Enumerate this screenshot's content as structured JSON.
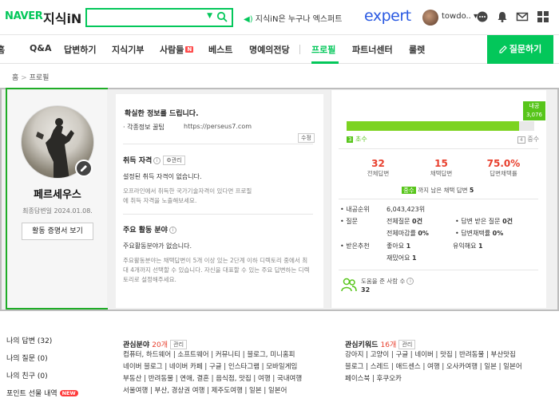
{
  "header": {
    "logo_naver": "NAVER",
    "logo_service": "지식iN",
    "promo_text": "지식iN은 누구나 엑스퍼트",
    "expert_logo": "expert",
    "user_name": "towdo..",
    "brand_color": "#03c75a"
  },
  "nav": {
    "items": [
      "홈",
      "Q&A",
      "답변하기",
      "지식기부",
      "사람들",
      "베스트",
      "명예의전당",
      "프로필",
      "파트너센터",
      "룰렛"
    ],
    "active": "프로필",
    "new_badge": "N",
    "ask_button": "질문하기"
  },
  "breadcrumb": {
    "home": "홈",
    "sep": ">",
    "current": "프로필"
  },
  "profile": {
    "name": "페르세우스",
    "last_answer": "최종답변일 2024.01.08.",
    "proof_button": "활동 증명서 보기"
  },
  "intro": {
    "headline": "확실한 정보를 드립니다.",
    "blog_label": "· 각종정보 꿀팁",
    "blog_url": "https://perseus7.com",
    "edit_button": "수정"
  },
  "qualification": {
    "title": "취득 자격",
    "manage": "관리",
    "none": "설정된 취득 자격이 없습니다.",
    "desc": "오프라인에서 취득한 국가기술자격이 있다면 프로필에 취득 자격을 노출해보세요."
  },
  "activity": {
    "title": "주요 활동 분야",
    "none": "주요활동분야가 없습니다.",
    "desc": "주요활동분야는 채택답변이 5개 이상 있는 2단계 이하 디렉토리 중에서 최대 4개까지 선택할 수 있습니다. 자신을 대표할 수 있는 주요 답변하는 디렉토리로 설정해주세요."
  },
  "level": {
    "badge_title": "내공",
    "badge_value": "3,076",
    "current": "초수",
    "current_num": "3",
    "next": "중수",
    "progress": 0.92
  },
  "stats": [
    {
      "value": "32",
      "label": "전체답변"
    },
    {
      "value": "15",
      "label": "채택답변"
    },
    {
      "value": "75.0%",
      "label": "답변채택률"
    }
  ],
  "next_level_note": {
    "badge": "중수",
    "text": "까지 남은 채택 답변",
    "count": "5"
  },
  "details": {
    "rank_label": "내공순위",
    "rank_value": "6,043,423위",
    "question_label": "질문",
    "total_q_label": "전체질문",
    "total_q": "0건",
    "q_close_label": "전체마감률",
    "q_close": "0%",
    "answer_recv_label": "답변 받은 질문",
    "answer_recv": "0건",
    "answer_adopt_label": "답변채택률",
    "answer_adopt": "0%",
    "recommend_label": "받은추천",
    "good_label": "좋아요",
    "good": "1",
    "useful_label": "유익해요",
    "useful": "1",
    "fun_label": "재밌어요",
    "fun": "1"
  },
  "helped": {
    "label": "도움을 준 사람 수",
    "value": "32"
  },
  "left_menu": {
    "my_answers": "나의 답변 (32)",
    "my_questions": "나의 질문 (0)",
    "my_friends": "나의 친구 (0)",
    "point_gifts": "포인트 선물 내역",
    "new": "NEW"
  },
  "interest": {
    "title": "관심분야",
    "count": "20개",
    "manage": "관리",
    "lines": [
      "컴퓨터, 하드웨어 | 소프트웨어 | 커뮤니티 | 블로그, 미니홈피",
      "네이버 블로그 | 네이버 카페 | 구글 | 인스타그램 | 모바일게임",
      "부동산 | 반려동물 | 연애, 결혼 | 음식점, 맛집 | 여행 | 국내여행",
      "서울여행 | 부산, 경상권 여행 | 제주도여행 | 일본 | 일본어"
    ]
  },
  "keywords": {
    "title": "관심키워드",
    "count": "16개",
    "manage": "관리",
    "lines": [
      "강아지 | 고양이 | 구글 | 네이버 | 맛집 | 반려동물 | 부산맛집",
      "블로그 | 스레드 | 애드센스 | 여행 | 오사카여행 | 일본 | 일본어",
      "페이스북 | 후쿠오카"
    ]
  }
}
